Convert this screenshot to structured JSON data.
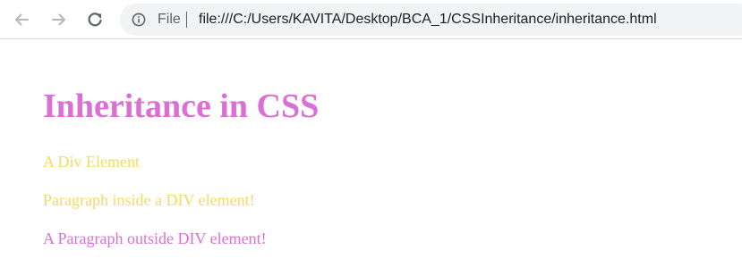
{
  "browser": {
    "scheme_label": "File",
    "url": "file:///C:/Users/KAVITA/Desktop/BCA_1/CSSInheritance/inheritance.html",
    "icons": {
      "back": "arrow-left-icon",
      "forward": "arrow-right-icon",
      "reload": "reload-icon",
      "info": "info-icon"
    }
  },
  "page": {
    "heading": "Inheritance in CSS",
    "div_text": "A Div Element",
    "paragraph_inside": "Paragraph inside a DIV element!",
    "paragraph_outside": "A Paragraph outside DIV element!"
  },
  "colors": {
    "heading": "#da70d6",
    "div_text": "#f7da5e",
    "paragraph_inside": "#f7da5e",
    "paragraph_outside": "#da70d6"
  }
}
